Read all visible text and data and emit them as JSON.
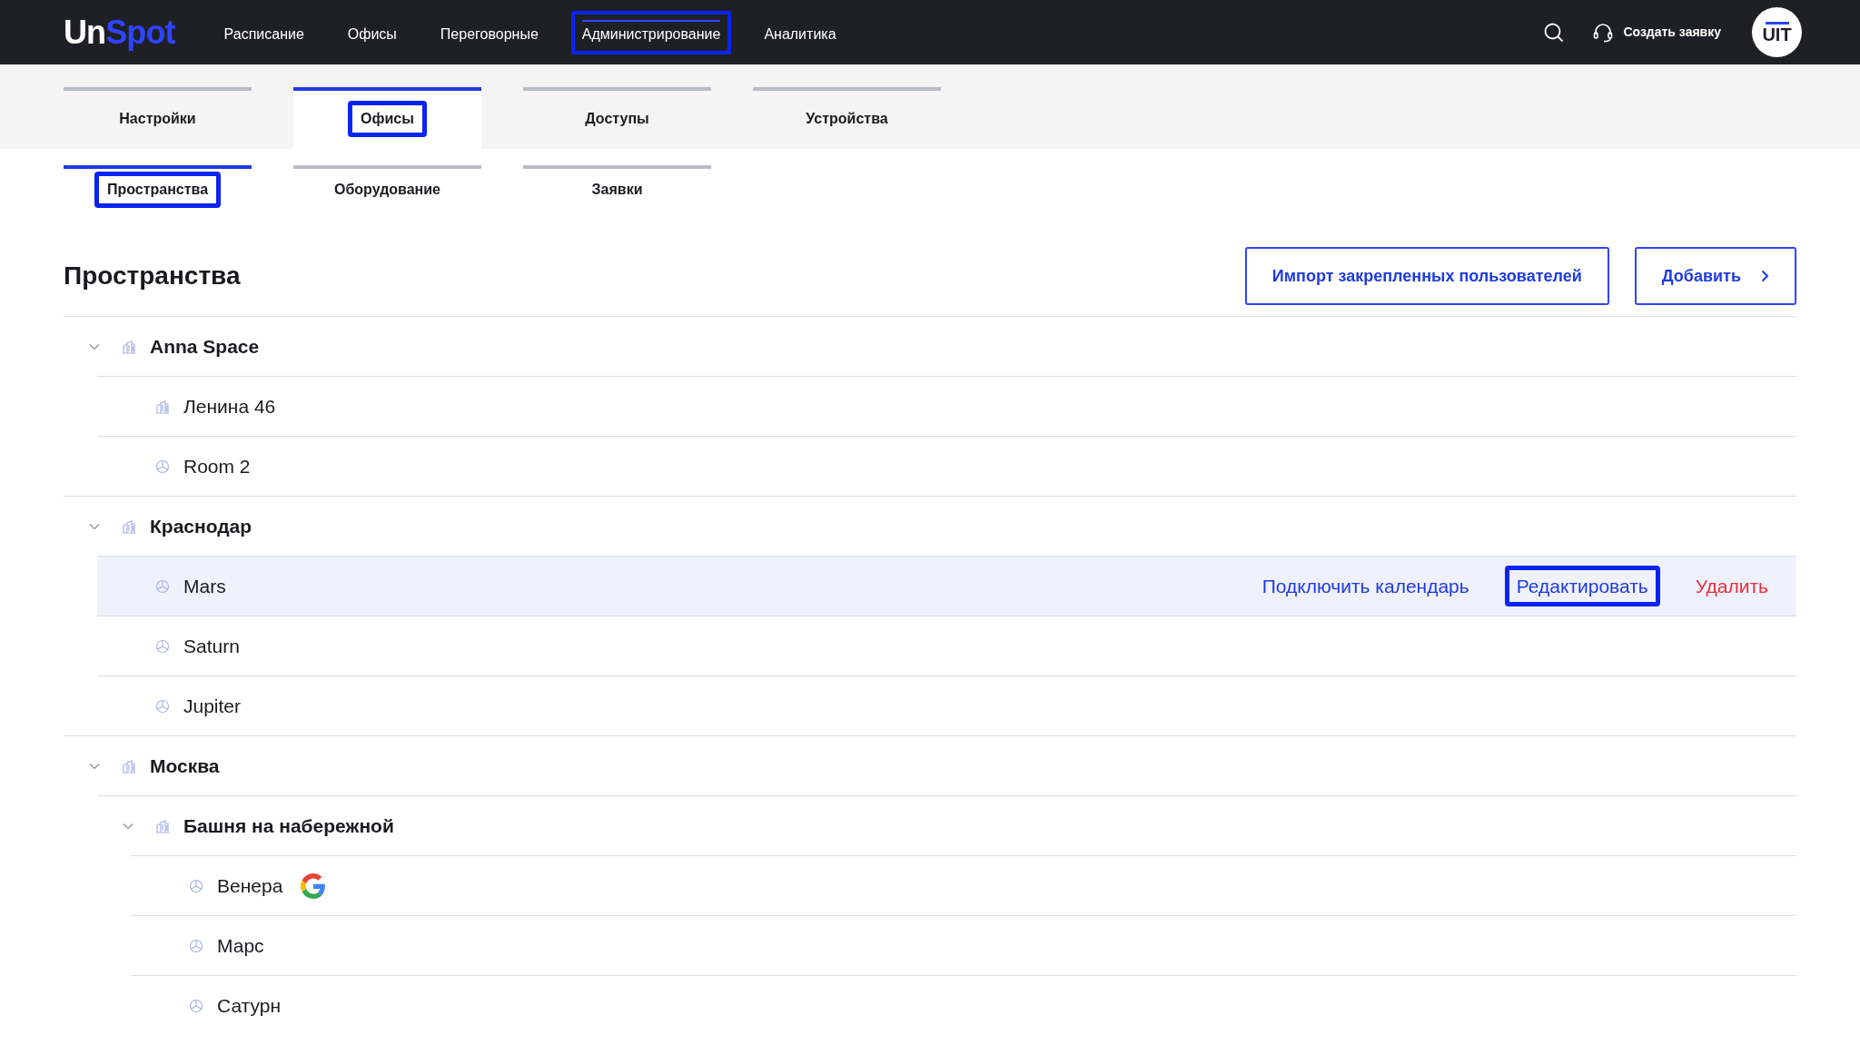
{
  "header": {
    "logo": {
      "part_1": "Un",
      "part_2": "Spot"
    },
    "nav": [
      {
        "label": "Расписание",
        "selected": false,
        "highlighted": false
      },
      {
        "label": "Офисы",
        "selected": false,
        "highlighted": false
      },
      {
        "label": "Переговорные",
        "selected": false,
        "highlighted": false
      },
      {
        "label": "Администрирование",
        "selected": true,
        "highlighted": true
      },
      {
        "label": "Аналитика",
        "selected": false,
        "highlighted": false
      }
    ],
    "support": "Создать заявку",
    "avatar": "UIT"
  },
  "tabs": [
    {
      "label": "Настройки",
      "selected": false,
      "highlighted": false
    },
    {
      "label": "Офисы",
      "selected": true,
      "highlighted": true
    },
    {
      "label": "Доступы",
      "selected": false,
      "highlighted": false
    },
    {
      "label": "Устройства",
      "selected": false,
      "highlighted": false
    }
  ],
  "subtabs": [
    {
      "label": "Пространства",
      "selected": true,
      "highlighted": true
    },
    {
      "label": "Оборудование",
      "selected": false,
      "highlighted": false
    },
    {
      "label": "Заявки",
      "selected": false,
      "highlighted": false
    }
  ],
  "title": "Пространства",
  "buttons": [
    {
      "label": "Импорт закрепленных пользователей",
      "kind": "plain"
    },
    {
      "label": "Добавить",
      "kind": "next"
    }
  ],
  "tree": [
    {
      "name": "Anna Space",
      "kind": "building",
      "expanded": true,
      "selected": false,
      "children": [
        {
          "name": "Ленина 46",
          "kind": "building",
          "selected": false
        },
        {
          "name": "Room 2",
          "kind": "room",
          "selected": false
        }
      ]
    },
    {
      "name": "Краснодар",
      "kind": "building",
      "expanded": true,
      "selected": false,
      "children": [
        {
          "name": "Mars",
          "kind": "room",
          "selected": true,
          "actions": [
            {
              "label": "Подключить календарь",
              "kind": "link",
              "highlighted": false
            },
            {
              "label": "Редактировать",
              "kind": "link",
              "highlighted": true
            },
            {
              "label": "Удалить",
              "kind": "danger",
              "highlighted": false
            }
          ]
        },
        {
          "name": "Saturn",
          "kind": "room",
          "selected": false
        },
        {
          "name": "Jupiter",
          "kind": "room",
          "selected": false
        }
      ]
    },
    {
      "name": "Москва",
      "kind": "building",
      "expanded": true,
      "selected": false,
      "children": [
        {
          "name": "Башня на набережной",
          "kind": "building",
          "expanded": true,
          "selected": false,
          "children": [
            {
              "name": "Венера",
              "kind": "room",
              "selected": false,
              "google_calendar": true
            },
            {
              "name": "Марс",
              "kind": "room",
              "selected": false
            },
            {
              "name": "Сатурн",
              "kind": "room",
              "selected": false
            }
          ]
        }
      ]
    }
  ]
}
